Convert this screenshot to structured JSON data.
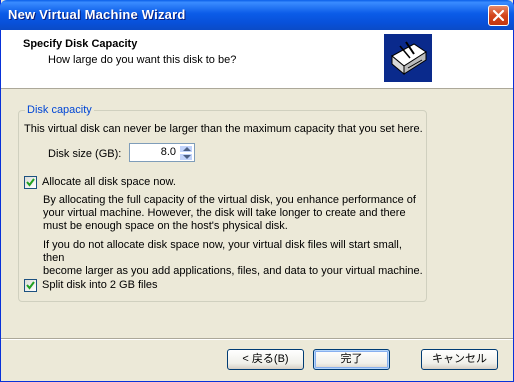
{
  "window": {
    "title": "New Virtual Machine Wizard"
  },
  "header": {
    "title": "Specify Disk Capacity",
    "subtitle": "How large do you want this disk to be?"
  },
  "disk_capacity": {
    "group_label": "Disk capacity",
    "max_note": "This virtual disk can never be larger than the maximum capacity that you set here.",
    "size_label": "Disk size (GB):",
    "size_value": "8.0"
  },
  "allocate": {
    "label": "Allocate all disk space now.",
    "checked": true,
    "desc_lines": [
      "By allocating the full capacity of the virtual disk, you enhance performance of",
      "your virtual machine.  However, the disk will take longer to create and there",
      "must be enough space on the host's physical disk."
    ],
    "desc2_lines": [
      "If you do not allocate disk space now, your virtual disk files will start small, then",
      "become larger as you add applications, files, and data to your virtual machine."
    ]
  },
  "split": {
    "label": "Split disk into 2 GB files",
    "checked": true
  },
  "buttons": {
    "back": "< 戻る(B)",
    "finish": "完了",
    "cancel": "キャンセル"
  }
}
